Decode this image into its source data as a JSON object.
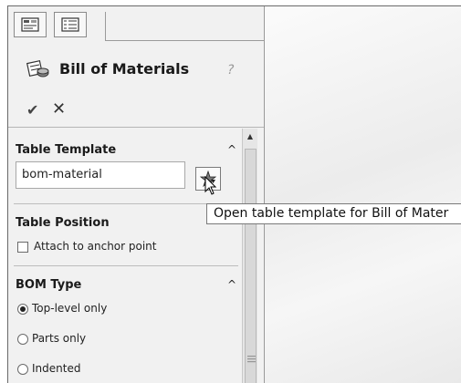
{
  "property_manager": {
    "title": "Bill of Materials",
    "help_symbol": "?",
    "ok_symbol": "✔",
    "cancel_symbol": "✕",
    "icons": [
      "property-manager-tab-icon",
      "feature-tree-tab-icon",
      "bill-of-materials-icon",
      "help-icon",
      "ok-check-icon",
      "cancel-x-icon",
      "open-template-star-icon",
      "arrow-cursor-icon"
    ]
  },
  "sections": {
    "table_template": {
      "title": "Table Template",
      "collapse_symbol": "^",
      "input_value": "bom-material"
    },
    "table_position": {
      "title": "Table Position",
      "checkbox_label": "Attach to anchor point",
      "checked": false
    },
    "bom_type": {
      "title": "BOM Type",
      "collapse_symbol": "^",
      "options": [
        {
          "label": "Top-level only",
          "checked": true
        },
        {
          "label": "Parts only",
          "checked": false
        },
        {
          "label": "Indented",
          "checked": false
        }
      ]
    }
  },
  "tooltip": {
    "text": "Open table template for Bill of Mater"
  },
  "colors": {
    "panel_bg": "#f1f1f1",
    "border": "#9a9a9a"
  }
}
